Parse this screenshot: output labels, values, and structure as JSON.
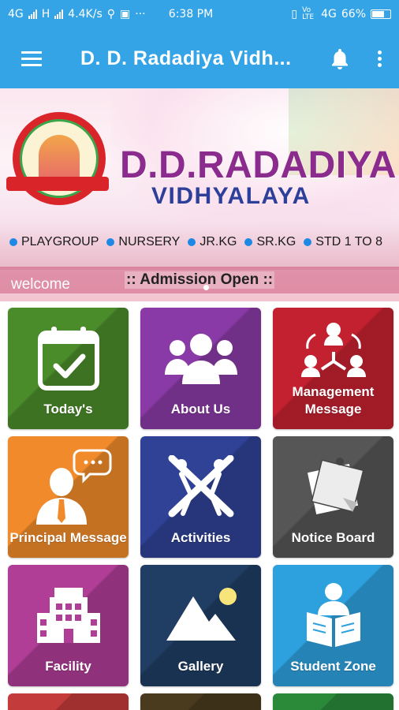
{
  "status": {
    "network_left": "4G",
    "network_left2": "H",
    "speed": "4.4K/s",
    "time": "6:38 PM",
    "volte": "Vo LTE",
    "network_right": "4G",
    "battery": "66%"
  },
  "app_bar": {
    "title": "D. D. Radadiya Vidh..."
  },
  "banner": {
    "school_name": "D.D.RADADIYA",
    "school_sub": "VIDHYALAYA",
    "programs": [
      "PLAYGROUP",
      "NURSERY",
      "JR.KG",
      "SR.KG",
      "STD 1 TO 8"
    ],
    "welcome": "welcome",
    "admission": ":: Admission Open ::"
  },
  "tiles": [
    {
      "label": "Today's",
      "color": "#4a8b2a",
      "icon": "calendar-check-icon"
    },
    {
      "label": "About Us",
      "color": "#8a3aa6",
      "icon": "group-icon"
    },
    {
      "label": "Management Message",
      "color": "#c42130",
      "icon": "hierarchy-icon"
    },
    {
      "label": "Principal Message",
      "color": "#f08a2a",
      "icon": "speaker-chat-icon"
    },
    {
      "label": "Activities",
      "color": "#2f4296",
      "icon": "activities-icon"
    },
    {
      "label": "Notice Board",
      "color": "#565656",
      "icon": "notes-icon"
    },
    {
      "label": "Facility",
      "color": "#b03d96",
      "icon": "building-icon"
    },
    {
      "label": "Gallery",
      "color": "#203d63",
      "icon": "image-icon"
    },
    {
      "label": "Student Zone",
      "color": "#2da0de",
      "icon": "reading-student-icon"
    }
  ],
  "partial_tiles": [
    {
      "color": "#c33b3b"
    },
    {
      "color": "#4a3a1e"
    },
    {
      "color": "#2a8a3a"
    }
  ]
}
